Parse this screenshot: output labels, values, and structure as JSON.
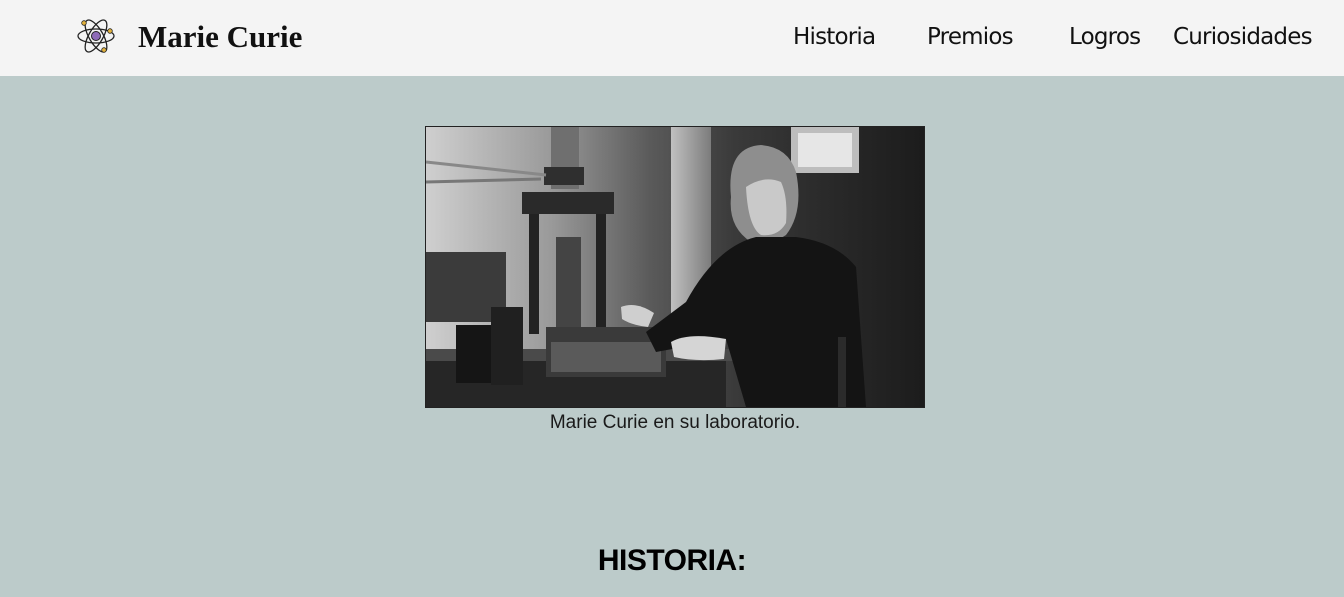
{
  "header": {
    "logo_icon": "atom-icon",
    "title": "Marie Curie",
    "nav": [
      {
        "label": "Historia"
      },
      {
        "label": "Premios"
      },
      {
        "label": "Logros"
      },
      {
        "label": "Curiosidades"
      }
    ]
  },
  "hero": {
    "image_description_icon": "photo-marie-curie-laboratory",
    "caption": "Marie Curie en su laboratorio."
  },
  "section": {
    "heading": "HISTORIA:"
  },
  "colors": {
    "background": "#bccbca",
    "header_bg": "#f4f4f4",
    "text": "#111111"
  }
}
